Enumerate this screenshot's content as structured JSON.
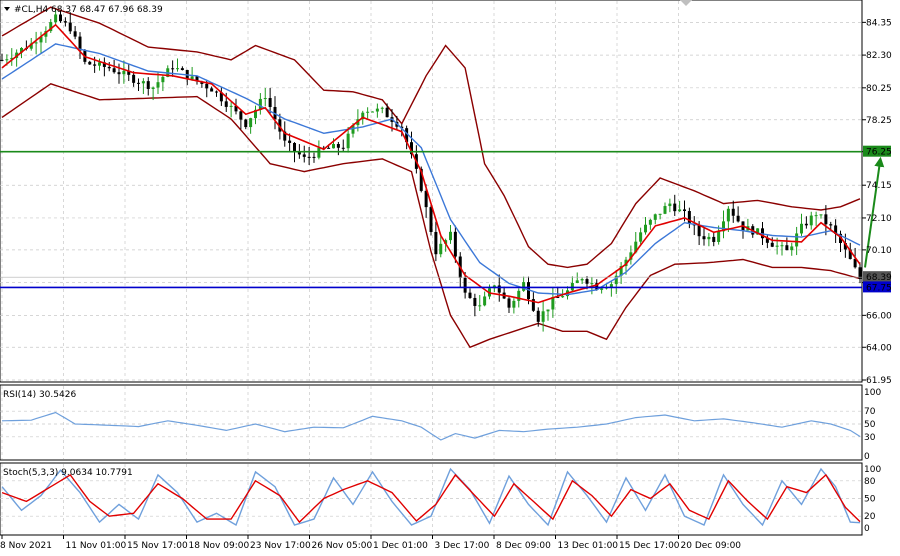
{
  "header": {
    "symbol_line": "#CL,H4  68.37 68.47 67.96 68.39",
    "rsi_title": "RSI(14) 30.5426",
    "stoch_title": "Stoch(5,3,3) 9.0634 10.7791"
  },
  "colors": {
    "background": "#ffffff",
    "grid": "#c8c8c8",
    "candle_up": "#1f9b1f",
    "candle_down": "#000000",
    "bollinger": "#8b0000",
    "ma_fast": "#e00000",
    "ma_slow": "#3c78d8",
    "resistance": "#1a8a1a",
    "support": "#0000cc",
    "arrow": "#1a8a1a",
    "rsi_line": "#6fa0dc",
    "stoch_main": "#6fa0dc",
    "stoch_signal": "#e00000",
    "axis_text": "#000000"
  },
  "chart_data": {
    "type": "candlestick",
    "symbol": "#CL",
    "timeframe": "H4",
    "last_ohlc": {
      "open": 68.37,
      "high": 68.47,
      "low": 67.96,
      "close": 68.39
    },
    "price_axis": {
      "min": 61.95,
      "max": 85.5,
      "ticks": [
        "84.35",
        "82.30",
        "80.25",
        "78.25",
        "76.25",
        "74.15",
        "72.10",
        "70.10",
        "68.05",
        "66.00",
        "64.00",
        "61.95"
      ]
    },
    "x_axis_labels": [
      "8 Nov 2021",
      "11 Nov 01:00",
      "15 Nov 17:00",
      "18 Nov 09:00",
      "23 Nov 17:00",
      "26 Nov 05:00",
      "1 Dec 01:00",
      "3 Dec 17:00",
      "8 Dec 09:00",
      "13 Dec 01:00",
      "15 Dec 17:00",
      "20 Dec 09:00"
    ],
    "levels": [
      {
        "name": "resistance",
        "value": 76.25,
        "label": "76.25"
      },
      {
        "name": "support",
        "value": 67.75,
        "label": "67.75"
      },
      {
        "name": "last-price",
        "value": 68.39,
        "label": "68.39"
      }
    ],
    "forecast_arrow": {
      "from_price": 69.0,
      "to_price": 76.0,
      "direction": "up"
    },
    "price_path": [
      {
        "i": 0,
        "p": 82.0
      },
      {
        "i": 6,
        "p": 83.0
      },
      {
        "i": 11,
        "p": 84.6
      },
      {
        "i": 14,
        "p": 84.0
      },
      {
        "i": 17,
        "p": 81.8
      },
      {
        "i": 22,
        "p": 81.5
      },
      {
        "i": 27,
        "p": 80.8
      },
      {
        "i": 31,
        "p": 80.3
      },
      {
        "i": 35,
        "p": 81.6
      },
      {
        "i": 39,
        "p": 80.8
      },
      {
        "i": 43,
        "p": 80.2
      },
      {
        "i": 47,
        "p": 79.0
      },
      {
        "i": 50,
        "p": 78.0
      },
      {
        "i": 54,
        "p": 79.8
      },
      {
        "i": 58,
        "p": 76.8
      },
      {
        "i": 62,
        "p": 75.8
      },
      {
        "i": 66,
        "p": 76.4
      },
      {
        "i": 70,
        "p": 76.6
      },
      {
        "i": 74,
        "p": 78.9
      },
      {
        "i": 78,
        "p": 78.8
      },
      {
        "i": 82,
        "p": 77.8
      },
      {
        "i": 86,
        "p": 74.0
      },
      {
        "i": 89,
        "p": 70.0
      },
      {
        "i": 92,
        "p": 71.0
      },
      {
        "i": 95,
        "p": 67.3
      },
      {
        "i": 98,
        "p": 66.5
      },
      {
        "i": 101,
        "p": 68.0
      },
      {
        "i": 104,
        "p": 66.5
      },
      {
        "i": 107,
        "p": 68.0
      },
      {
        "i": 110,
        "p": 65.8
      },
      {
        "i": 113,
        "p": 66.9
      },
      {
        "i": 116,
        "p": 67.5
      },
      {
        "i": 119,
        "p": 68.4
      },
      {
        "i": 122,
        "p": 67.8
      },
      {
        "i": 125,
        "p": 68.0
      },
      {
        "i": 128,
        "p": 69.5
      },
      {
        "i": 131,
        "p": 71.2
      },
      {
        "i": 134,
        "p": 72.2
      },
      {
        "i": 137,
        "p": 73.0
      },
      {
        "i": 140,
        "p": 72.3
      },
      {
        "i": 143,
        "p": 71.0
      },
      {
        "i": 146,
        "p": 70.8
      },
      {
        "i": 149,
        "p": 72.8
      },
      {
        "i": 152,
        "p": 71.5
      },
      {
        "i": 155,
        "p": 71.2
      },
      {
        "i": 158,
        "p": 70.5
      },
      {
        "i": 161,
        "p": 70.0
      },
      {
        "i": 164,
        "p": 71.5
      },
      {
        "i": 167,
        "p": 72.4
      },
      {
        "i": 170,
        "p": 71.5
      },
      {
        "i": 173,
        "p": 70.0
      },
      {
        "i": 176,
        "p": 68.3
      }
    ],
    "bollinger_upper": [
      {
        "i": 0,
        "p": 83.5
      },
      {
        "i": 10,
        "p": 85.3
      },
      {
        "i": 20,
        "p": 84.3
      },
      {
        "i": 30,
        "p": 82.8
      },
      {
        "i": 40,
        "p": 82.5
      },
      {
        "i": 47,
        "p": 82.0
      },
      {
        "i": 52,
        "p": 82.9
      },
      {
        "i": 60,
        "p": 82.0
      },
      {
        "i": 66,
        "p": 80.1
      },
      {
        "i": 72,
        "p": 80.0
      },
      {
        "i": 78,
        "p": 79.5
      },
      {
        "i": 82,
        "p": 78.0
      },
      {
        "i": 87,
        "p": 81.0
      },
      {
        "i": 91,
        "p": 82.9
      },
      {
        "i": 95,
        "p": 81.5
      },
      {
        "i": 99,
        "p": 75.5
      },
      {
        "i": 103,
        "p": 73.5
      },
      {
        "i": 108,
        "p": 70.3
      },
      {
        "i": 112,
        "p": 69.2
      },
      {
        "i": 116,
        "p": 69.0
      },
      {
        "i": 120,
        "p": 69.2
      },
      {
        "i": 125,
        "p": 70.5
      },
      {
        "i": 130,
        "p": 73.0
      },
      {
        "i": 135,
        "p": 74.6
      },
      {
        "i": 142,
        "p": 73.8
      },
      {
        "i": 148,
        "p": 73.0
      },
      {
        "i": 155,
        "p": 73.2
      },
      {
        "i": 162,
        "p": 72.8
      },
      {
        "i": 168,
        "p": 72.6
      },
      {
        "i": 172,
        "p": 72.8
      },
      {
        "i": 176,
        "p": 73.3
      }
    ],
    "bollinger_lower": [
      {
        "i": 0,
        "p": 78.4
      },
      {
        "i": 10,
        "p": 80.5
      },
      {
        "i": 20,
        "p": 79.5
      },
      {
        "i": 30,
        "p": 79.6
      },
      {
        "i": 40,
        "p": 79.7
      },
      {
        "i": 47,
        "p": 78.3
      },
      {
        "i": 55,
        "p": 75.5
      },
      {
        "i": 62,
        "p": 75.0
      },
      {
        "i": 70,
        "p": 75.5
      },
      {
        "i": 78,
        "p": 75.8
      },
      {
        "i": 84,
        "p": 75.0
      },
      {
        "i": 88,
        "p": 70.0
      },
      {
        "i": 92,
        "p": 66.0
      },
      {
        "i": 96,
        "p": 64.0
      },
      {
        "i": 100,
        "p": 64.5
      },
      {
        "i": 105,
        "p": 65.0
      },
      {
        "i": 110,
        "p": 65.5
      },
      {
        "i": 115,
        "p": 65.0
      },
      {
        "i": 120,
        "p": 65.0
      },
      {
        "i": 124,
        "p": 64.5
      },
      {
        "i": 128,
        "p": 66.5
      },
      {
        "i": 133,
        "p": 68.5
      },
      {
        "i": 138,
        "p": 69.2
      },
      {
        "i": 145,
        "p": 69.3
      },
      {
        "i": 152,
        "p": 69.5
      },
      {
        "i": 158,
        "p": 69.0
      },
      {
        "i": 164,
        "p": 69.0
      },
      {
        "i": 170,
        "p": 68.8
      },
      {
        "i": 176,
        "p": 68.3
      }
    ],
    "ma_fast": [
      {
        "i": 0,
        "p": 81.5
      },
      {
        "i": 11,
        "p": 84.2
      },
      {
        "i": 17,
        "p": 82.2
      },
      {
        "i": 27,
        "p": 81.2
      },
      {
        "i": 35,
        "p": 81.0
      },
      {
        "i": 43,
        "p": 80.5
      },
      {
        "i": 50,
        "p": 78.6
      },
      {
        "i": 54,
        "p": 79.0
      },
      {
        "i": 58,
        "p": 77.4
      },
      {
        "i": 66,
        "p": 76.4
      },
      {
        "i": 74,
        "p": 78.4
      },
      {
        "i": 82,
        "p": 77.5
      },
      {
        "i": 86,
        "p": 75.0
      },
      {
        "i": 90,
        "p": 71.0
      },
      {
        "i": 95,
        "p": 68.5
      },
      {
        "i": 100,
        "p": 67.4
      },
      {
        "i": 104,
        "p": 67.2
      },
      {
        "i": 110,
        "p": 66.8
      },
      {
        "i": 116,
        "p": 67.4
      },
      {
        "i": 122,
        "p": 67.9
      },
      {
        "i": 128,
        "p": 69.2
      },
      {
        "i": 134,
        "p": 71.6
      },
      {
        "i": 140,
        "p": 72.1
      },
      {
        "i": 146,
        "p": 71.2
      },
      {
        "i": 152,
        "p": 71.6
      },
      {
        "i": 158,
        "p": 70.7
      },
      {
        "i": 164,
        "p": 70.6
      },
      {
        "i": 168,
        "p": 71.8
      },
      {
        "i": 172,
        "p": 70.9
      },
      {
        "i": 176,
        "p": 69.2
      }
    ],
    "ma_slow": [
      {
        "i": 0,
        "p": 80.8
      },
      {
        "i": 11,
        "p": 83.0
      },
      {
        "i": 20,
        "p": 82.4
      },
      {
        "i": 30,
        "p": 81.3
      },
      {
        "i": 40,
        "p": 81.0
      },
      {
        "i": 50,
        "p": 79.6
      },
      {
        "i": 58,
        "p": 78.3
      },
      {
        "i": 66,
        "p": 77.4
      },
      {
        "i": 74,
        "p": 77.8
      },
      {
        "i": 80,
        "p": 78.3
      },
      {
        "i": 86,
        "p": 76.5
      },
      {
        "i": 92,
        "p": 72.0
      },
      {
        "i": 98,
        "p": 69.3
      },
      {
        "i": 104,
        "p": 68.0
      },
      {
        "i": 110,
        "p": 67.4
      },
      {
        "i": 116,
        "p": 67.3
      },
      {
        "i": 122,
        "p": 67.6
      },
      {
        "i": 128,
        "p": 68.7
      },
      {
        "i": 134,
        "p": 70.5
      },
      {
        "i": 140,
        "p": 71.8
      },
      {
        "i": 146,
        "p": 71.5
      },
      {
        "i": 152,
        "p": 71.3
      },
      {
        "i": 158,
        "p": 71.0
      },
      {
        "i": 164,
        "p": 70.9
      },
      {
        "i": 170,
        "p": 71.3
      },
      {
        "i": 176,
        "p": 70.4
      }
    ],
    "rsi": {
      "period": 14,
      "value": 30.5426,
      "range": [
        0,
        100
      ],
      "levels": [
        70,
        50,
        30
      ],
      "level_labels": [
        "100",
        "70",
        "50",
        "30",
        "0"
      ],
      "series": [
        {
          "i": 0,
          "v": 55
        },
        {
          "i": 6,
          "v": 56
        },
        {
          "i": 11,
          "v": 68
        },
        {
          "i": 15,
          "v": 50
        },
        {
          "i": 22,
          "v": 48
        },
        {
          "i": 28,
          "v": 46
        },
        {
          "i": 34,
          "v": 55
        },
        {
          "i": 40,
          "v": 48
        },
        {
          "i": 46,
          "v": 40
        },
        {
          "i": 52,
          "v": 50
        },
        {
          "i": 58,
          "v": 38
        },
        {
          "i": 64,
          "v": 45
        },
        {
          "i": 70,
          "v": 44
        },
        {
          "i": 76,
          "v": 62
        },
        {
          "i": 82,
          "v": 55
        },
        {
          "i": 86,
          "v": 45
        },
        {
          "i": 90,
          "v": 25
        },
        {
          "i": 93,
          "v": 35
        },
        {
          "i": 97,
          "v": 28
        },
        {
          "i": 102,
          "v": 40
        },
        {
          "i": 107,
          "v": 38
        },
        {
          "i": 112,
          "v": 42
        },
        {
          "i": 118,
          "v": 45
        },
        {
          "i": 124,
          "v": 50
        },
        {
          "i": 130,
          "v": 60
        },
        {
          "i": 136,
          "v": 64
        },
        {
          "i": 142,
          "v": 55
        },
        {
          "i": 148,
          "v": 58
        },
        {
          "i": 154,
          "v": 52
        },
        {
          "i": 160,
          "v": 45
        },
        {
          "i": 166,
          "v": 55
        },
        {
          "i": 170,
          "v": 50
        },
        {
          "i": 174,
          "v": 40
        },
        {
          "i": 176,
          "v": 30.5
        }
      ]
    },
    "stochastic": {
      "params": "5,3,3",
      "main_value": 9.0634,
      "signal_value": 10.7791,
      "range": [
        0,
        100
      ],
      "levels": [
        80,
        50,
        20
      ],
      "level_labels": [
        "100",
        "80",
        "50",
        "20",
        "0"
      ],
      "main": [
        {
          "i": 0,
          "v": 70
        },
        {
          "i": 4,
          "v": 30
        },
        {
          "i": 8,
          "v": 55
        },
        {
          "i": 12,
          "v": 98
        },
        {
          "i": 16,
          "v": 60
        },
        {
          "i": 20,
          "v": 10
        },
        {
          "i": 24,
          "v": 40
        },
        {
          "i": 28,
          "v": 15
        },
        {
          "i": 32,
          "v": 90
        },
        {
          "i": 36,
          "v": 60
        },
        {
          "i": 40,
          "v": 10
        },
        {
          "i": 44,
          "v": 25
        },
        {
          "i": 48,
          "v": 5
        },
        {
          "i": 52,
          "v": 95
        },
        {
          "i": 56,
          "v": 70
        },
        {
          "i": 60,
          "v": 5
        },
        {
          "i": 64,
          "v": 15
        },
        {
          "i": 68,
          "v": 85
        },
        {
          "i": 72,
          "v": 40
        },
        {
          "i": 76,
          "v": 95
        },
        {
          "i": 80,
          "v": 45
        },
        {
          "i": 84,
          "v": 5
        },
        {
          "i": 88,
          "v": 20
        },
        {
          "i": 92,
          "v": 100
        },
        {
          "i": 96,
          "v": 65
        },
        {
          "i": 100,
          "v": 8
        },
        {
          "i": 104,
          "v": 88
        },
        {
          "i": 108,
          "v": 40
        },
        {
          "i": 112,
          "v": 5
        },
        {
          "i": 116,
          "v": 95
        },
        {
          "i": 120,
          "v": 55
        },
        {
          "i": 124,
          "v": 10
        },
        {
          "i": 128,
          "v": 85
        },
        {
          "i": 132,
          "v": 30
        },
        {
          "i": 136,
          "v": 90
        },
        {
          "i": 140,
          "v": 20
        },
        {
          "i": 144,
          "v": 5
        },
        {
          "i": 148,
          "v": 90
        },
        {
          "i": 152,
          "v": 40
        },
        {
          "i": 156,
          "v": 5
        },
        {
          "i": 160,
          "v": 80
        },
        {
          "i": 164,
          "v": 40
        },
        {
          "i": 168,
          "v": 100
        },
        {
          "i": 171,
          "v": 70
        },
        {
          "i": 174,
          "v": 10
        },
        {
          "i": 176,
          "v": 9
        }
      ],
      "signal": [
        {
          "i": 0,
          "v": 60
        },
        {
          "i": 5,
          "v": 45
        },
        {
          "i": 10,
          "v": 70
        },
        {
          "i": 14,
          "v": 90
        },
        {
          "i": 18,
          "v": 45
        },
        {
          "i": 22,
          "v": 20
        },
        {
          "i": 27,
          "v": 25
        },
        {
          "i": 32,
          "v": 75
        },
        {
          "i": 37,
          "v": 50
        },
        {
          "i": 42,
          "v": 15
        },
        {
          "i": 47,
          "v": 15
        },
        {
          "i": 52,
          "v": 80
        },
        {
          "i": 57,
          "v": 55
        },
        {
          "i": 61,
          "v": 10
        },
        {
          "i": 66,
          "v": 50
        },
        {
          "i": 70,
          "v": 65
        },
        {
          "i": 75,
          "v": 80
        },
        {
          "i": 80,
          "v": 60
        },
        {
          "i": 85,
          "v": 12
        },
        {
          "i": 89,
          "v": 40
        },
        {
          "i": 93,
          "v": 90
        },
        {
          "i": 97,
          "v": 55
        },
        {
          "i": 101,
          "v": 20
        },
        {
          "i": 105,
          "v": 75
        },
        {
          "i": 109,
          "v": 45
        },
        {
          "i": 113,
          "v": 15
        },
        {
          "i": 117,
          "v": 80
        },
        {
          "i": 121,
          "v": 55
        },
        {
          "i": 125,
          "v": 20
        },
        {
          "i": 129,
          "v": 65
        },
        {
          "i": 133,
          "v": 50
        },
        {
          "i": 137,
          "v": 75
        },
        {
          "i": 141,
          "v": 30
        },
        {
          "i": 145,
          "v": 15
        },
        {
          "i": 149,
          "v": 80
        },
        {
          "i": 153,
          "v": 45
        },
        {
          "i": 157,
          "v": 15
        },
        {
          "i": 161,
          "v": 70
        },
        {
          "i": 165,
          "v": 60
        },
        {
          "i": 169,
          "v": 90
        },
        {
          "i": 173,
          "v": 35
        },
        {
          "i": 176,
          "v": 10.8
        }
      ]
    }
  }
}
